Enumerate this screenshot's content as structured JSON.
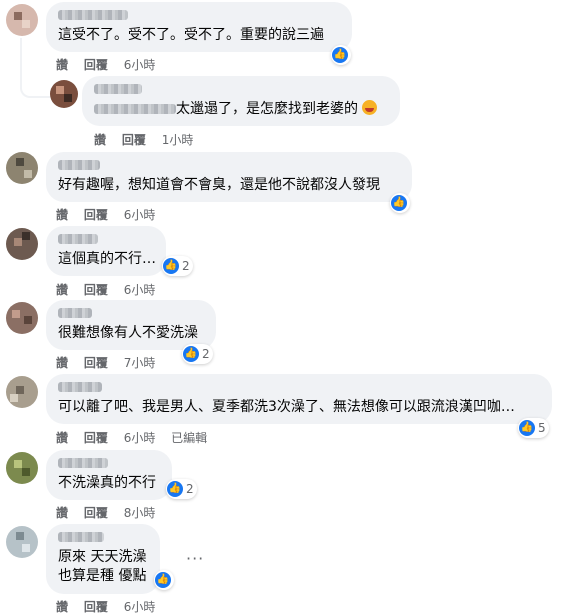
{
  "colors": {
    "like_blue": "#1877f2",
    "bubble_bg": "#f0f2f5",
    "meta_gray": "#65676b"
  },
  "comments": [
    {
      "text": "這受不了。受不了。受不了。重要的說三遍",
      "actions": {
        "like": "讚",
        "reply": "回覆",
        "time": "6小時"
      },
      "reaction": {
        "icon": "like-icon",
        "count": ""
      }
    },
    {
      "text": "太邋遢了，是怎麼找到老婆的",
      "actions": {
        "like": "讚",
        "reply": "回覆",
        "time": "1小時"
      },
      "reaction": {
        "icon": "laugh-emoji",
        "count": ""
      }
    },
    {
      "text": "好有趣喔，想知道會不會臭，還是他不說都沒人發現",
      "actions": {
        "like": "讚",
        "reply": "回覆",
        "time": "6小時"
      },
      "reaction": {
        "icon": "like-icon",
        "count": ""
      }
    },
    {
      "text": "這個真的不行…",
      "actions": {
        "like": "讚",
        "reply": "回覆",
        "time": "6小時"
      },
      "reaction": {
        "icon": "like-icon",
        "count": "2"
      }
    },
    {
      "text": "很難想像有人不愛洗澡",
      "actions": {
        "like": "讚",
        "reply": "回覆",
        "time": "7小時"
      },
      "reaction": {
        "icon": "like-icon",
        "count": "2"
      }
    },
    {
      "text": "可以離了吧、我是男人、夏季都洗3次澡了、無法想像可以跟流浪漢凹咖…",
      "actions": {
        "like": "讚",
        "reply": "回覆",
        "time": "6小時",
        "edited": "已編輯"
      },
      "reaction": {
        "icon": "like-icon",
        "count": "5"
      }
    },
    {
      "text": "不洗澡真的不行",
      "actions": {
        "like": "讚",
        "reply": "回覆",
        "time": "8小時"
      },
      "reaction": {
        "icon": "like-icon",
        "count": "2"
      }
    },
    {
      "text_line1": "原來 天天洗澡",
      "text_line2": "也算是種 優點",
      "actions": {
        "like": "讚",
        "reply": "回覆",
        "time": "6小時"
      },
      "reaction": {
        "icon": "like-icon",
        "count": ""
      },
      "more": "···"
    }
  ]
}
